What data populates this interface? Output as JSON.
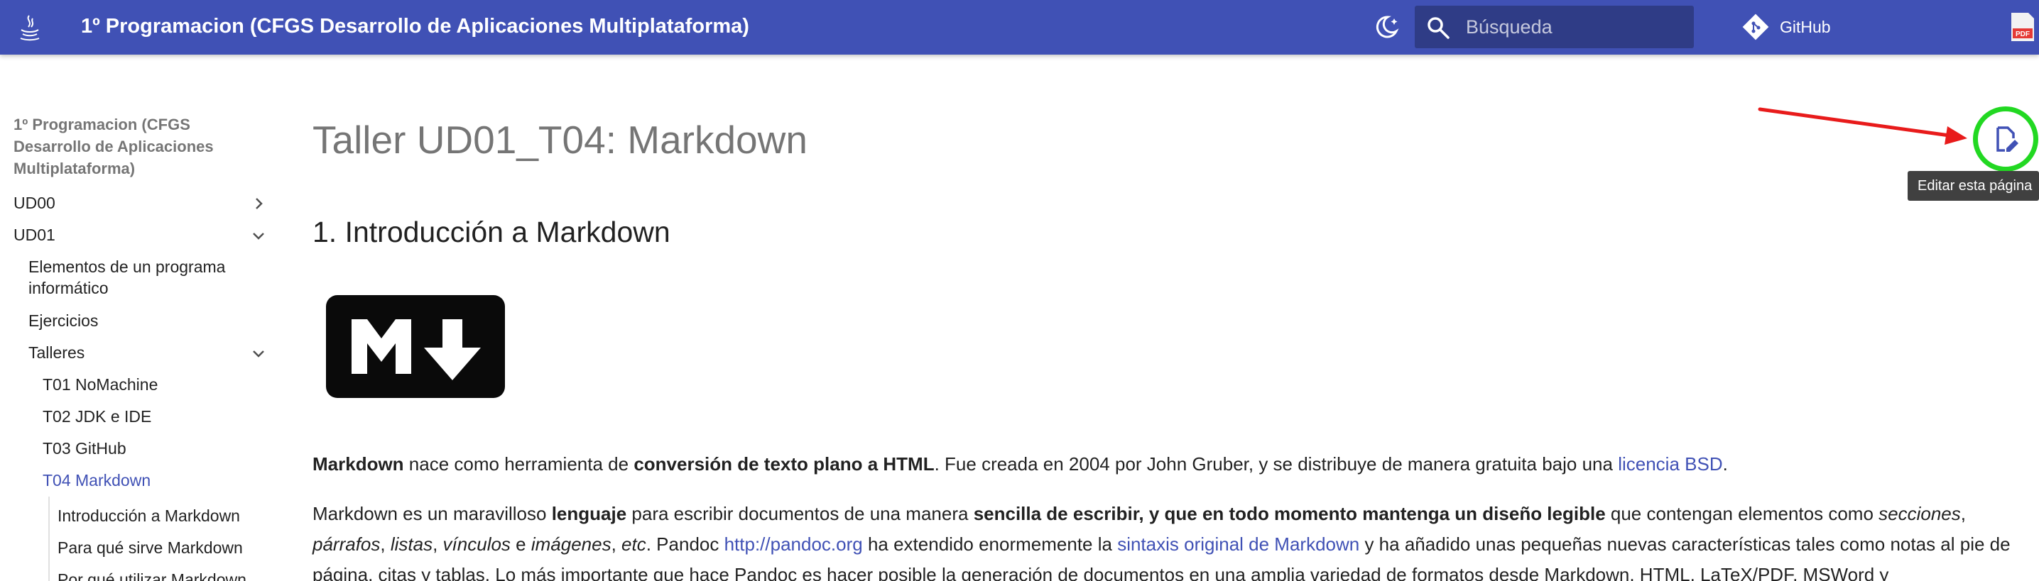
{
  "header": {
    "site_title": "1º Programacion (CFGS Desarrollo de Aplicaciones Multiplataforma)",
    "search_placeholder": "Búsqueda",
    "github_label": "GitHub",
    "colors": {
      "primary": "#4051b5",
      "accent_link": "#4051b5",
      "annotation_circle": "#22d822",
      "annotation_arrow": "#e81b1b"
    },
    "icons": [
      "java-logo-icon",
      "theme-toggle-icon",
      "search-icon",
      "git-icon",
      "pdf-icon"
    ]
  },
  "sidebar": {
    "title": "1º Programacion (CFGS Desarrollo de Aplicaciones Multiplataforma)",
    "items": [
      {
        "label": "UD00",
        "expanded": false
      },
      {
        "label": "UD01",
        "expanded": true
      },
      {
        "label": "Elementos de un programa informático"
      },
      {
        "label": "Ejercicios"
      },
      {
        "label": "Talleres",
        "expanded": true
      },
      {
        "label": "T01 NoMachine"
      },
      {
        "label": "T02 JDK e IDE"
      },
      {
        "label": "T03 GitHub"
      },
      {
        "label": "T04 Markdown",
        "active": true
      },
      {
        "label": "Introducción a Markdown"
      },
      {
        "label": "Para qué sirve Markdown"
      },
      {
        "label": "Por qué utilizar Markdown"
      }
    ]
  },
  "main": {
    "title": "Taller UD01_T04: Markdown",
    "section_heading": "1. Introducción a Markdown",
    "p1": {
      "b1": "Markdown",
      "t1": " nace como herramienta de ",
      "b2": "conversión de texto plano a HTML",
      "t2": ". Fue creada en 2004 por John Gruber, y se distribuye de manera gratuita bajo una ",
      "link": "licencia BSD",
      "t3": "."
    },
    "p2": {
      "t1": "Markdown es un maravilloso ",
      "b1": "lenguaje",
      "t2": " para escribir documentos de una manera ",
      "b2": "sencilla de escribir, y que en todo momento mantenga un diseño legible",
      "t3": " que contengan elementos como ",
      "i1": "secciones",
      "t4": ", ",
      "i2": "párrafos",
      "t5": ", ",
      "i3": "listas",
      "t6": ", ",
      "i4": "vínculos",
      "t7": " e ",
      "i5": "imágenes",
      "t8": ", ",
      "i6": "etc",
      "t9": ". Pandoc ",
      "link1": "http://pandoc.org",
      "t10": " ha extendido enormemente la ",
      "link2": "sintaxis original de Markdown",
      "t11": " y ha añadido unas pequeñas nuevas características tales como notas al pie de página, citas y tablas. Lo más importante que hace Pandoc es hacer posible la generación de documentos en una amplia variedad de formatos desde Markdown, HTML, LaTeX/PDF, MSWord y"
    },
    "edit_tooltip": "Editar esta página"
  }
}
